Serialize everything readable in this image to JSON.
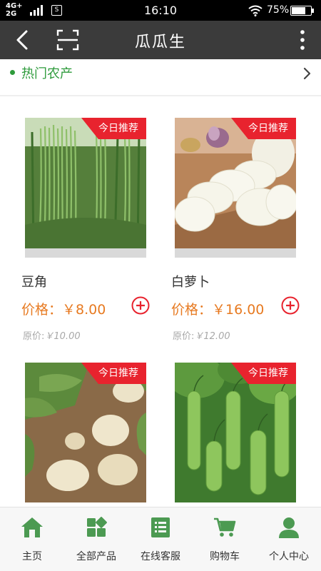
{
  "status_bar": {
    "network_top": "4G+",
    "network_bottom": "2G",
    "app_icon_glyph": "S",
    "time": "16:10",
    "battery_text": "75%",
    "battery_level": 0.75
  },
  "header": {
    "title": "瓜瓜生",
    "back_icon": "chevron-left-icon",
    "scan_icon": "scan-icon",
    "more_icon": "more-vertical-icon"
  },
  "section": {
    "title": "热门农产",
    "accent_color": "#2e9b3c",
    "arrow_icon": "chevron-right-icon"
  },
  "products": [
    {
      "name": "豆角",
      "badge": "今日推荐",
      "price": "价格：￥8.00",
      "orig_label": "原价:",
      "orig_value": "￥10.00",
      "image": "green-beans"
    },
    {
      "name": "白萝卜",
      "badge": "今日推荐",
      "price": "价格：￥16.00",
      "orig_label": "原价:",
      "orig_value": "￥12.00",
      "image": "white-radish"
    },
    {
      "name": "",
      "badge": "今日推荐",
      "price": "",
      "orig_label": "",
      "orig_value": "",
      "image": "potatoes"
    },
    {
      "name": "",
      "badge": "今日推荐",
      "price": "",
      "orig_label": "",
      "orig_value": "",
      "image": "cucumbers"
    }
  ],
  "tabs": [
    {
      "label": "主页",
      "icon": "home-icon"
    },
    {
      "label": "全部产品",
      "icon": "grid-icon"
    },
    {
      "label": "在线客服",
      "icon": "list-icon"
    },
    {
      "label": "购物车",
      "icon": "cart-icon"
    },
    {
      "label": "个人中心",
      "icon": "user-icon"
    }
  ],
  "colors": {
    "badge": "#e8232e",
    "price": "#e77a21",
    "tab_icon": "#4c9a52",
    "header_bg": "#3b3b3b"
  }
}
